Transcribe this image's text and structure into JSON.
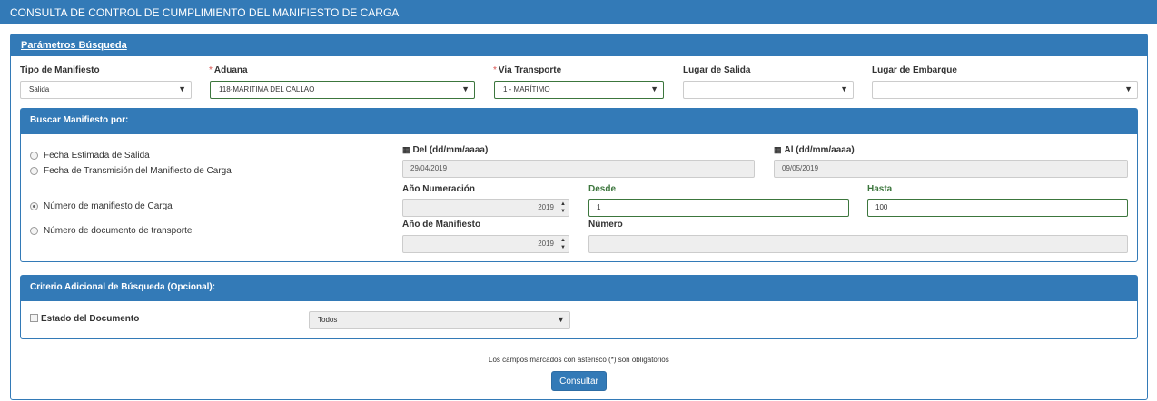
{
  "page": {
    "title": "CONSULTA DE CONTROL DE CUMPLIMIENTO DEL MANIFIESTO DE CARGA"
  },
  "params": {
    "heading": "Parámetros Búsqueda",
    "fields": {
      "tipo": {
        "label": "Tipo de Manifiesto",
        "value": "Salida"
      },
      "aduana": {
        "required": "*",
        "label": "Aduana",
        "value": "118-MARITIMA DEL CALLAO"
      },
      "via": {
        "required": "*",
        "label": "Via Transporte",
        "value": "1 - MARÍTIMO"
      },
      "lugar_salida": {
        "label": "Lugar de Salida",
        "value": ""
      },
      "lugar_embarque": {
        "label": "Lugar de Embarque",
        "value": ""
      }
    }
  },
  "buscar": {
    "heading": "Buscar Manifiesto por:",
    "options": [
      "Fecha Estimada de Salida",
      "Fecha de Transmisión del Manifiesto de Carga",
      "Número de manifiesto de Carga",
      "Número de documento de transporte"
    ],
    "selected_index": 2,
    "del": {
      "label": "Del (dd/mm/aaaa)",
      "value": "29/04/2019"
    },
    "al": {
      "label": "Al (dd/mm/aaaa)",
      "value": "09/05/2019"
    },
    "anio_numeracion": {
      "label": "Año Numeración",
      "value": "2019"
    },
    "desde": {
      "label": "Desde",
      "value": "1"
    },
    "hasta": {
      "label": "Hasta",
      "value": "100"
    },
    "anio_manifiesto": {
      "label": "Año de Manifiesto",
      "value": "2019"
    },
    "numero": {
      "label": "Número",
      "value": ""
    }
  },
  "criterio": {
    "heading": "Criterio Adicional de Búsqueda (Opcional):",
    "estado_label": "Estado del Documento",
    "estado_value": "Todos"
  },
  "footer": {
    "note": "Los campos marcados con asterisco (*) son obligatorios",
    "submit": "Consultar"
  }
}
